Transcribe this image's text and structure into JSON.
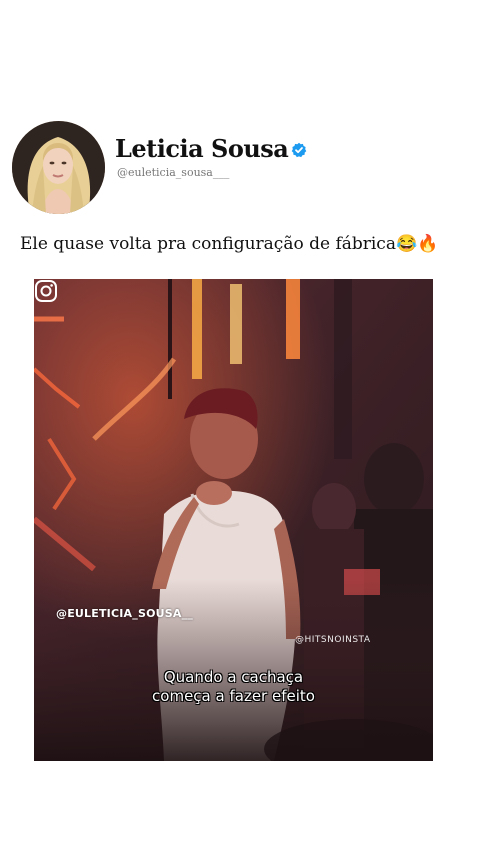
{
  "post": {
    "author": {
      "display_name": "Leticia Sousa",
      "handle": "@euleticia_sousa___",
      "verified": true,
      "verified_color": "#1d9bf0"
    },
    "caption": "Ele quase volta pra configuração de fábrica😂🔥",
    "media": {
      "overlay_handle": "@EULETICIA_SOUSA__",
      "watermark": "@HITSNOINSTA",
      "subtitle_line1": "Quando a cachaça",
      "subtitle_line2": "começa a fazer efeito"
    }
  },
  "icons": {
    "verified": "verified-badge-icon",
    "instagram": "instagram-icon"
  }
}
